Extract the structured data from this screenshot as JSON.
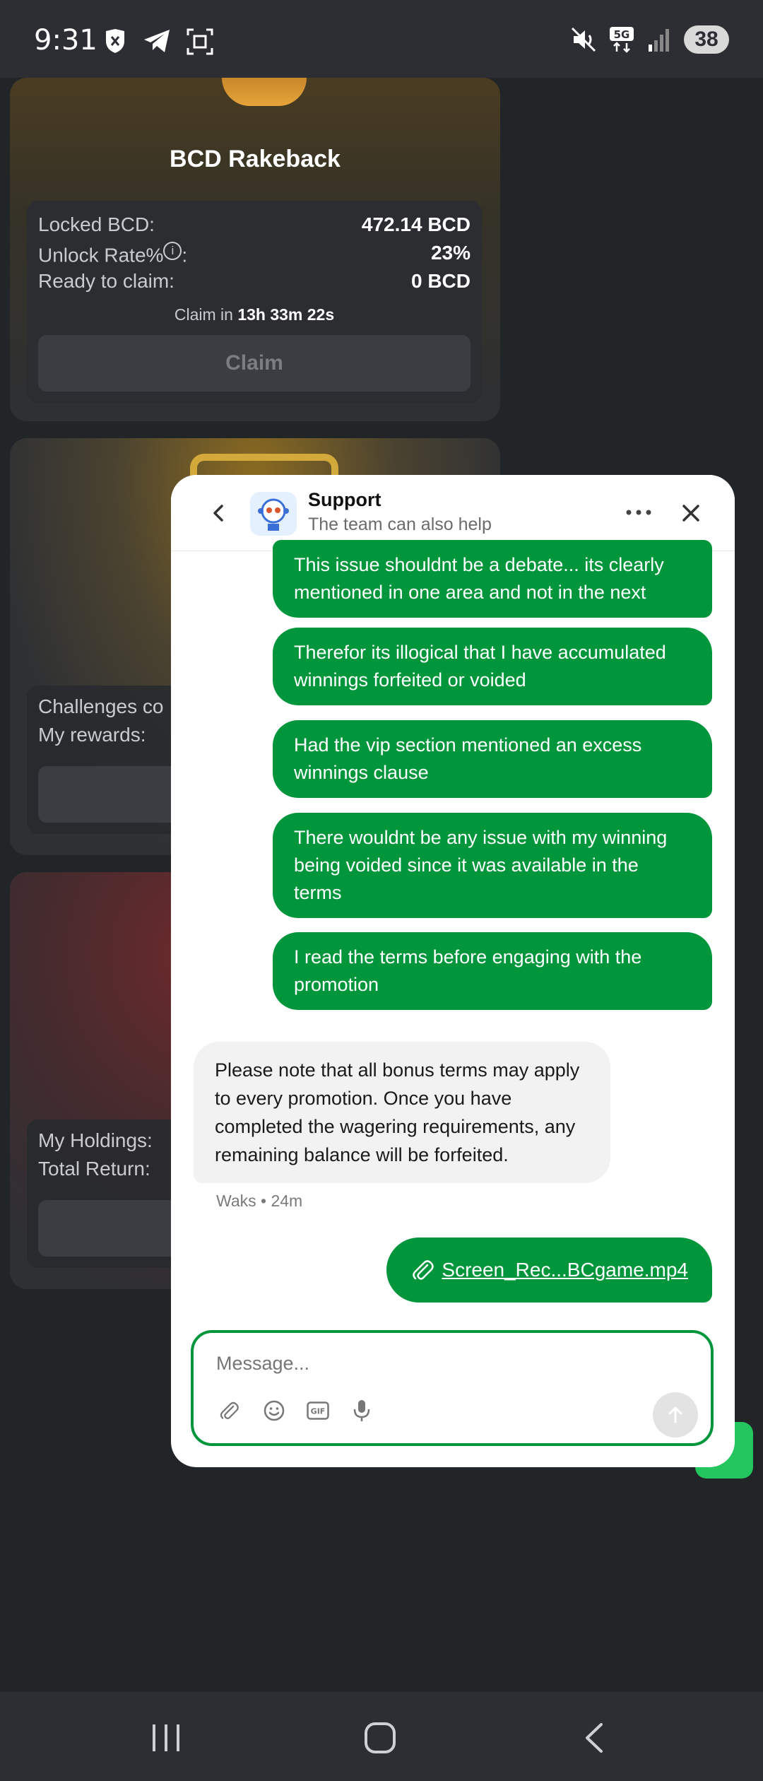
{
  "status_bar": {
    "time": "9:31",
    "icons_left": [
      "shield-icon",
      "telegram-icon",
      "screenshot-icon"
    ],
    "icons_right": [
      "mute-icon",
      "5g-icon",
      "signal-icon"
    ],
    "battery": "38"
  },
  "rakeback_card": {
    "title": "BCD Rakeback",
    "locked_label": "Locked BCD:",
    "locked_value": "472.14 BCD",
    "unlock_label": "Unlock Rate%",
    "unlock_suffix": ":",
    "unlock_info": "i",
    "unlock_value": "23%",
    "ready_label": "Ready to claim:",
    "ready_value": "0 BCD",
    "claim_in_prefix": "Claim in",
    "claim_in_time": "13h 33m 22s",
    "claim_button": "Claim"
  },
  "challenges_card": {
    "label1": "Challenges co",
    "label2": "My rewards:"
  },
  "holdings_card": {
    "label1": "My Holdings:",
    "label2": "Total Return:"
  },
  "chat": {
    "title": "Support",
    "subtitle": "The team can also help",
    "messages_out": [
      "This issue shouldnt be a debate... its clearly mentioned in one area and not in the next",
      "Therefor its illogical that I have accumulated winnings forfeited or voided",
      "Had the vip section mentioned an excess winnings clause",
      "There wouldnt be any issue with my winning being voided since it was available in the terms",
      "I read the terms before engaging with the promotion"
    ],
    "message_in": "Please note that all bonus terms may apply to every promotion. Once you have completed the wagering requirements, any remaining balance will be forfeited.",
    "message_in_meta": "Waks • 24m",
    "attachment": "Screen_Rec...BCgame.mp4",
    "composer_placeholder": "Message..."
  },
  "colors": {
    "accent_green": "#01963b",
    "background": "#222528"
  }
}
